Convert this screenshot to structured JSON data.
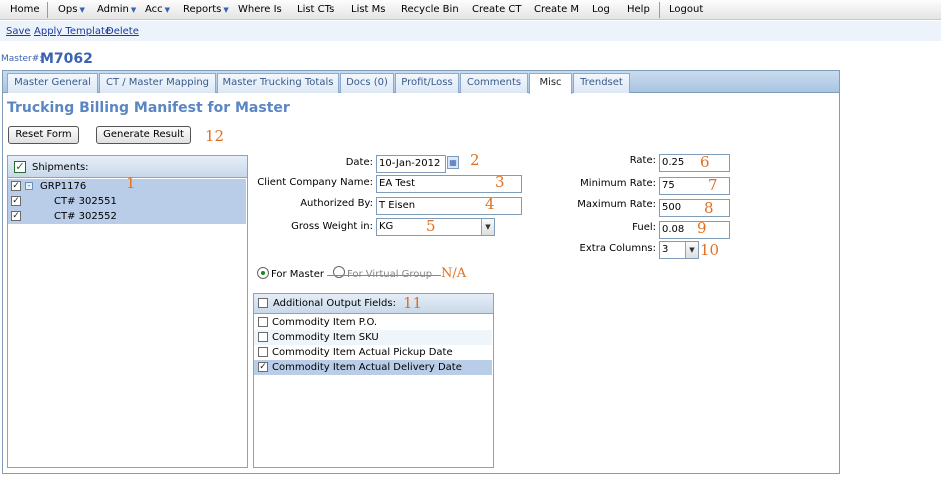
{
  "nav": {
    "items": [
      {
        "label": "Home"
      },
      {
        "label": "Ops"
      },
      {
        "label": "Admin"
      },
      {
        "label": "Acc"
      },
      {
        "label": "Reports"
      },
      {
        "label": "Where Is"
      },
      {
        "label": "List CTs"
      },
      {
        "label": "List Ms"
      },
      {
        "label": "Recycle Bin"
      },
      {
        "label": "Create CT"
      },
      {
        "label": "Create M"
      },
      {
        "label": "Log"
      },
      {
        "label": "Help"
      },
      {
        "label": "Logout"
      }
    ]
  },
  "actions": {
    "save": "Save",
    "apply_template": "Apply Template",
    "delete": "Delete"
  },
  "master": {
    "label": "Master#:",
    "id": "M7062"
  },
  "tabs": [
    {
      "label": "Master General"
    },
    {
      "label": "CT / Master Mapping"
    },
    {
      "label": "Master Trucking Totals"
    },
    {
      "label": "Docs (0)"
    },
    {
      "label": "Profit/Loss"
    },
    {
      "label": "Comments"
    },
    {
      "label": "Misc"
    },
    {
      "label": "Trendset"
    }
  ],
  "page_title": "Trucking Billing Manifest for Master",
  "buttons": {
    "reset": "Reset Form",
    "generate": "Generate Result"
  },
  "shipments": {
    "header": "Shipments:",
    "group": "GRP1176",
    "items": [
      {
        "label": "CT# 302551"
      },
      {
        "label": "CT# 302552"
      }
    ]
  },
  "form": {
    "date": {
      "label": "Date:",
      "value": "10-Jan-2012"
    },
    "client": {
      "label": "Client Company Name:",
      "value": "EA Test"
    },
    "authorized": {
      "label": "Authorized By:",
      "value": "T Eisen"
    },
    "gross_weight": {
      "label": "Gross Weight in:",
      "value": "KG"
    },
    "rate": {
      "label": "Rate:",
      "value": "0.25"
    },
    "min_rate": {
      "label": "Minimum Rate:",
      "value": "75"
    },
    "max_rate": {
      "label": "Maximum Rate:",
      "value": "500"
    },
    "fuel": {
      "label": "Fuel:",
      "value": "0.08"
    },
    "extra_columns": {
      "label": "Extra Columns:",
      "value": "3"
    }
  },
  "radios": {
    "for_master": "For Master",
    "for_virtual_group": "For Virtual Group",
    "na_note": "N/A"
  },
  "output_fields": {
    "header": "Additional Output Fields:",
    "items": [
      {
        "label": "Commodity Item P.O.",
        "checked": false
      },
      {
        "label": "Commodity Item SKU",
        "checked": false
      },
      {
        "label": "Commodity Item Actual Pickup Date",
        "checked": false
      },
      {
        "label": "Commodity Item Actual Delivery Date",
        "checked": true
      }
    ]
  },
  "annotations": [
    "1",
    "2",
    "3",
    "4",
    "5",
    "6",
    "7",
    "8",
    "9",
    "10",
    "11",
    "12"
  ]
}
